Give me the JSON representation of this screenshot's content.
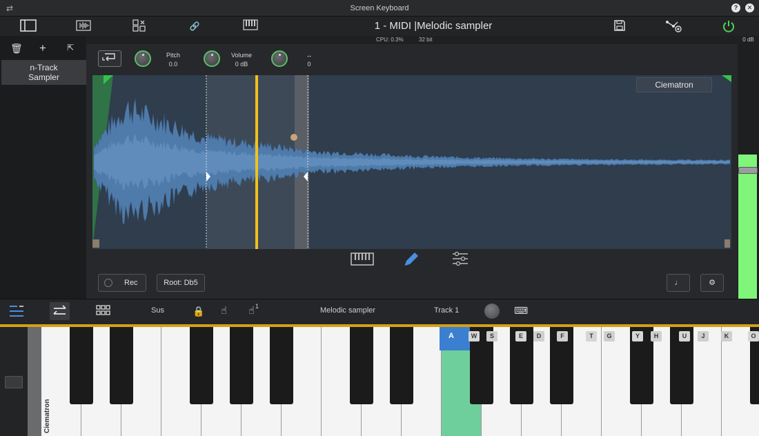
{
  "window": {
    "title": "Screen Keyboard",
    "help_label": "?",
    "close_label": "✕"
  },
  "toolbar": {
    "track_title": "1 - MIDI |Melodic sampler",
    "cpu": "CPU: 0.3%",
    "bits": "32 bit"
  },
  "left_panel": {
    "instrument_line1": "n-Track",
    "instrument_line2": "Sampler"
  },
  "sampler": {
    "knobs": [
      {
        "label": "Pitch",
        "value": "0.0"
      },
      {
        "label": "Volume",
        "value": "0 dB"
      },
      {
        "label": "↔",
        "value": "0"
      }
    ],
    "preset": "Ciematron",
    "rec_label": "Rec",
    "root_label": "Root: Db5"
  },
  "meter": {
    "label": "0 dB",
    "level": 0.75
  },
  "kb_toolbar": {
    "sus": "Sus",
    "instrument": "Melodic sampler",
    "track": "Track 1",
    "finger_count": "1"
  },
  "keyboard": {
    "vertical_label": "Ciematron",
    "white_hints": [
      "A",
      "S",
      "D",
      "F",
      "G",
      "H",
      "J",
      "K"
    ],
    "black_hints": [
      "W",
      "E",
      "T",
      "Y",
      "U",
      "O"
    ],
    "active_hint": "A"
  },
  "colors": {
    "accent": "#d4a017",
    "meter": "#7ff57a",
    "pressed_key": "#6fcf9c",
    "active_hint": "#3b7fd0",
    "knob_ring": "#5bbf6a"
  }
}
